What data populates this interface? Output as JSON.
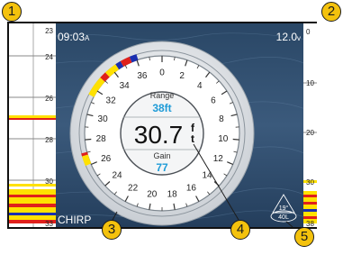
{
  "status_bar": {
    "time": "09:03",
    "time_suffix": "A",
    "voltage": "12.0",
    "voltage_unit": "v"
  },
  "left_sonar": {
    "depth_labels": [
      "23",
      "24",
      "26",
      "28",
      "30",
      "33"
    ],
    "mode_label": "CHIRP"
  },
  "right_sonar": {
    "depth_labels": [
      "0",
      "10",
      "20",
      "30",
      "38"
    ]
  },
  "dial": {
    "scale_labels": [
      "0",
      "2",
      "4",
      "6",
      "8",
      "10",
      "12",
      "14",
      "16",
      "18",
      "20",
      "22",
      "24",
      "26",
      "28",
      "30",
      "32",
      "34",
      "36"
    ],
    "range_label": "Range",
    "range_value": "38ft",
    "depth_value": "30.7",
    "depth_unit_top": "f",
    "depth_unit_bottom": "t",
    "gain_label": "Gain",
    "gain_value": "77"
  },
  "temperature_gauge": {
    "temperature": "19°",
    "depth": "40L"
  },
  "callouts": [
    "1",
    "2",
    "3",
    "4",
    "5"
  ],
  "colors": {
    "accent_blue": "#1e9bd7",
    "callout_yellow": "#f4c20d",
    "sonar_yellow": "#ffe100",
    "sonar_red": "#e0201b",
    "sonar_blue": "#1a2fb0",
    "water": "#2e4a6b"
  }
}
